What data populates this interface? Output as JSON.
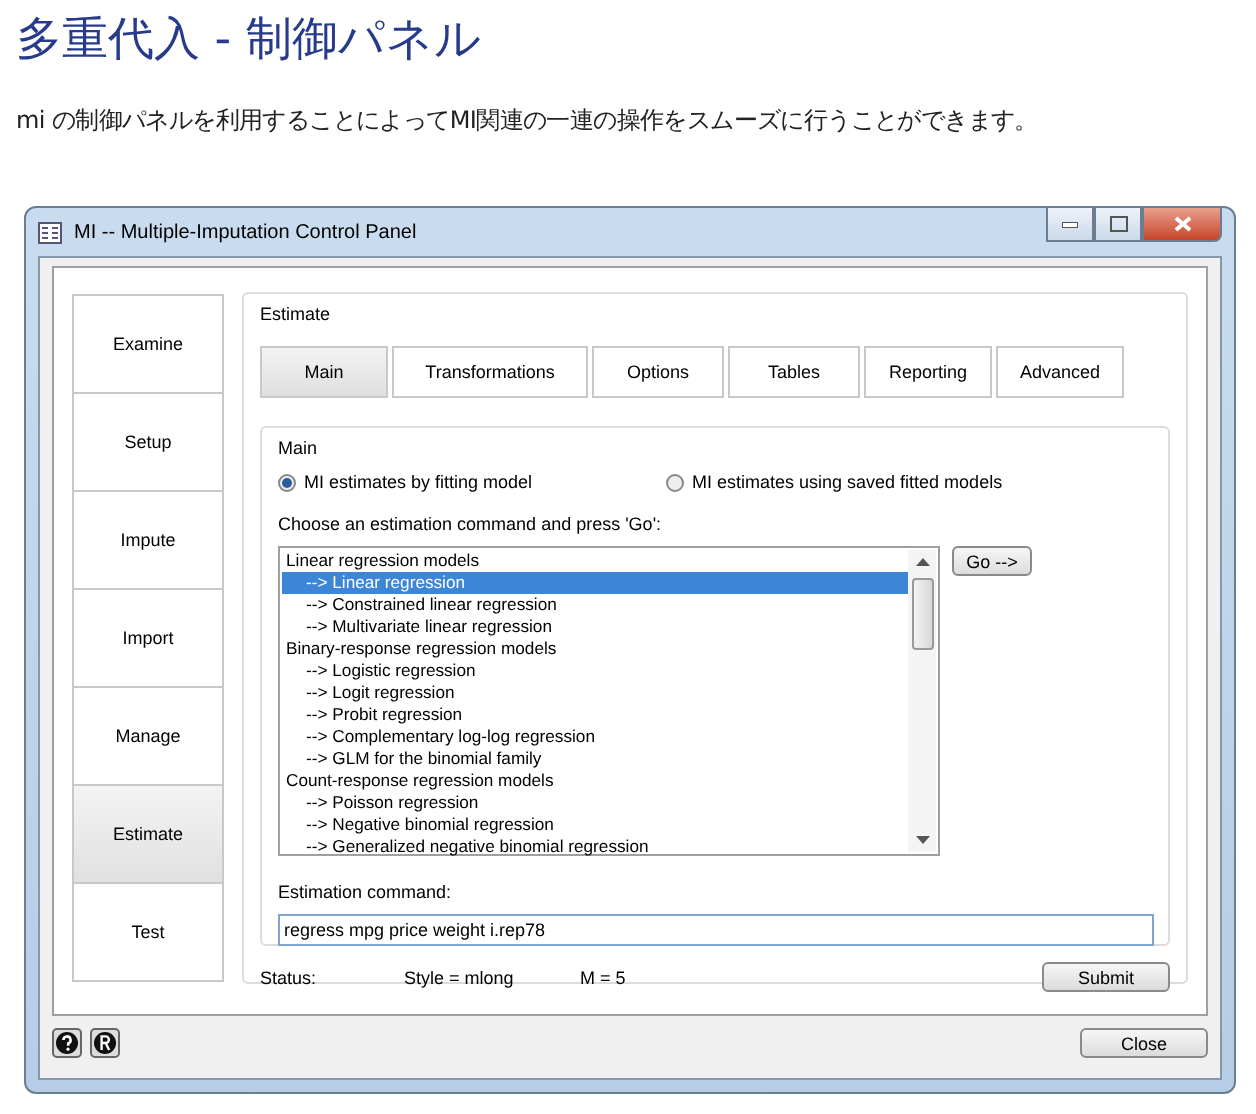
{
  "heading": "多重代入 - 制御パネル",
  "intro": "mi の制御パネルを利用することによってMI関連の一連の操作をスムーズに行うことができます。",
  "window": {
    "title": "MI -- Multiple-Imputation Control Panel"
  },
  "nav": [
    {
      "label": "Examine",
      "selected": false
    },
    {
      "label": "Setup",
      "selected": false
    },
    {
      "label": "Impute",
      "selected": false
    },
    {
      "label": "Import",
      "selected": false
    },
    {
      "label": "Manage",
      "selected": false
    },
    {
      "label": "Estimate",
      "selected": true
    },
    {
      "label": "Test",
      "selected": false
    }
  ],
  "group_title": "Estimate",
  "tabs": [
    {
      "label": "Main",
      "selected": true
    },
    {
      "label": "Transformations",
      "selected": false
    },
    {
      "label": "Options",
      "selected": false
    },
    {
      "label": "Tables",
      "selected": false
    },
    {
      "label": "Reporting",
      "selected": false
    },
    {
      "label": "Advanced",
      "selected": false
    }
  ],
  "main": {
    "title": "Main",
    "radios": [
      {
        "label": "MI estimates by fitting model",
        "selected": true
      },
      {
        "label": "MI estimates using saved fitted models",
        "selected": false
      }
    ],
    "list_prompt": "Choose an estimation command and press 'Go':",
    "list": [
      {
        "label": "Linear regression models",
        "kind": "header",
        "selected": false
      },
      {
        "label": "--> Linear regression",
        "kind": "item",
        "selected": true
      },
      {
        "label": "--> Constrained linear regression",
        "kind": "item",
        "selected": false
      },
      {
        "label": "--> Multivariate linear regression",
        "kind": "item",
        "selected": false
      },
      {
        "label": "Binary-response regression models",
        "kind": "header",
        "selected": false
      },
      {
        "label": "--> Logistic regression",
        "kind": "item",
        "selected": false
      },
      {
        "label": "--> Logit regression",
        "kind": "item",
        "selected": false
      },
      {
        "label": "--> Probit regression",
        "kind": "item",
        "selected": false
      },
      {
        "label": "--> Complementary log-log regression",
        "kind": "item",
        "selected": false
      },
      {
        "label": "--> GLM for the binomial family",
        "kind": "item",
        "selected": false
      },
      {
        "label": "Count-response regression models",
        "kind": "header",
        "selected": false
      },
      {
        "label": "--> Poisson regression",
        "kind": "item",
        "selected": false
      },
      {
        "label": "--> Negative binomial regression",
        "kind": "item",
        "selected": false
      },
      {
        "label": "--> Generalized negative binomial regression",
        "kind": "item",
        "selected": false
      }
    ],
    "go_button": "Go -->",
    "command_label": "Estimation command:",
    "command_value": "regress mpg price weight i.rep78"
  },
  "status": {
    "label": "Status:",
    "style": "Style = mlong",
    "m": "M = 5"
  },
  "submit": "Submit",
  "close": "Close"
}
